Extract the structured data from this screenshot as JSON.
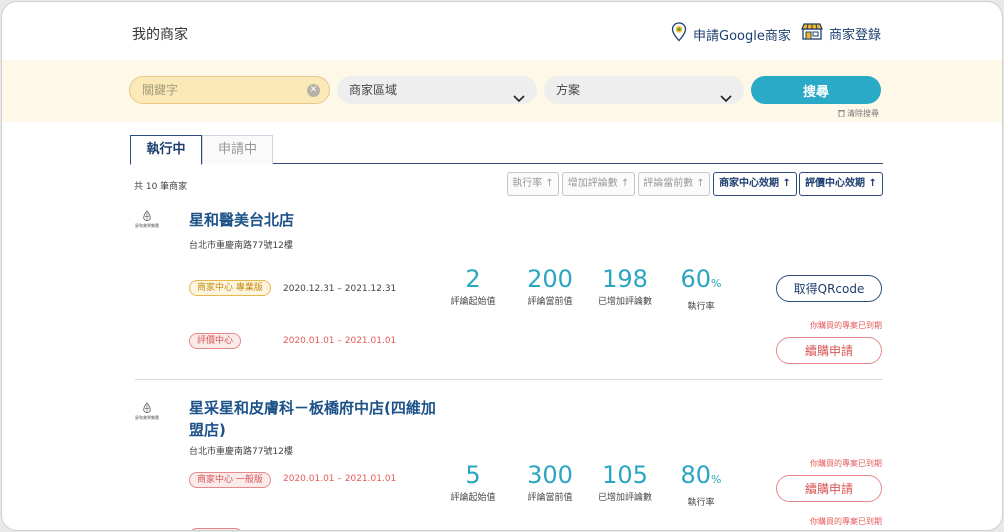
{
  "header": {
    "title": "我的商家",
    "apply_google_label": "申請Google商家",
    "merchant_login_label": "商家登錄"
  },
  "search": {
    "keyword_placeholder": "關鍵字",
    "region_label": "商家區域",
    "plan_label": "方案",
    "submit_label": "搜尋",
    "clear_label": "清除搜尋"
  },
  "tabs": [
    {
      "label": "執行中",
      "active": true
    },
    {
      "label": "申請中",
      "active": false
    }
  ],
  "list": {
    "total_text": "共 10 筆商家",
    "sort_buttons": [
      {
        "label": "執行率 ↑",
        "active": false
      },
      {
        "label": "增加評論數 ↑",
        "active": false
      },
      {
        "label": "評論當前數 ↑",
        "active": false
      },
      {
        "label": "商家中心效期 ↑",
        "active": true
      },
      {
        "label": "評價中心效期 ↑",
        "active": true
      }
    ]
  },
  "merchants": [
    {
      "logo_text": "星和美學集團",
      "name": "星和醫美台北店",
      "address": "台北市重慶南路77號12樓",
      "merchant_center": {
        "badge": "商家中心 專業版",
        "dates": "2020.12.31 – 2021.12.31"
      },
      "review_center": {
        "badge": "評價中心",
        "dates": "2020.01.01 – 2021.01.01"
      },
      "stats": [
        {
          "value": "2",
          "label": "評論起始值"
        },
        {
          "value": "200",
          "label": "評論當前值"
        },
        {
          "value": "198",
          "label": "已增加評論數"
        },
        {
          "value": "60",
          "unit": "%",
          "label": "執行率"
        }
      ],
      "qr_button": "取得QRcode",
      "expired_note": "你購買的專案已到期",
      "renew_button": "續購申請"
    },
    {
      "logo_text": "星和美學集團",
      "name_line1": "星采星和皮膚科－板橋府中店(四維加",
      "name_line2": "盟店)",
      "address": "台北市重慶南路77號12樓",
      "merchant_center": {
        "badge": "商家中心 一般版",
        "dates": "2020.01.01 – 2021.01.01"
      },
      "stats": [
        {
          "value": "5",
          "label": "評論起始值"
        },
        {
          "value": "300",
          "label": "評論當前值"
        },
        {
          "value": "105",
          "label": "已增加評論數"
        },
        {
          "value": "80",
          "unit": "%",
          "label": "執行率"
        }
      ],
      "expired_note": "你購買的專案已到期",
      "renew_button": "續購申請",
      "expired_note_2": "你購買的專案已到期"
    }
  ],
  "colors": {
    "primary_navy": "#1d3e6e",
    "accent_teal": "#2aa6c3",
    "search_band": "#fdf8e8",
    "gold_badge": "#c58d12",
    "expired_red": "#e35b5b"
  },
  "icons": {
    "apply_google": "map-pin-icon",
    "merchant_login": "storefront-icon",
    "select_arrow": "chevron-down-icon",
    "clear": "close-circle-icon",
    "clear_search": "trash-icon"
  }
}
